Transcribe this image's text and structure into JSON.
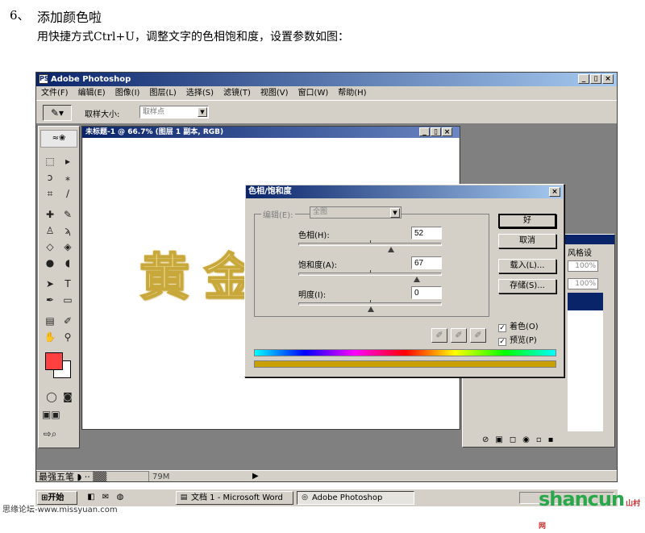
{
  "article": {
    "step_number": "6、",
    "step_title": "添加颜色啦",
    "step_desc": "用快捷方式Ctrl+U，调整文字的色相饱和度，设置参数如图："
  },
  "app": {
    "title": "Adobe Photoshop",
    "logo": "PS",
    "win_buttons": [
      "_",
      "▯",
      "×"
    ],
    "menus": [
      "文件(F)",
      "编辑(E)",
      "图像(I)",
      "图层(L)",
      "选择(S)",
      "滤镜(T)",
      "视图(V)",
      "窗口(W)",
      "帮助(H)"
    ],
    "options": {
      "tool_icon": "eyedropper-icon",
      "sample_label": "取样大小:",
      "sample_value": "取样点",
      "select_arrow": "▼"
    },
    "toolbox_logo": "≈❀"
  },
  "document": {
    "title": "未标题-1 @ 66.7% (图层 1 副本, RGB)",
    "canvas_text": "黄金"
  },
  "layers_panel": {
    "tab": "风格设",
    "opacity": "100%",
    "fill": "100%",
    "bottom_icons": "⊘▣◻◉▫▪"
  },
  "status_bar": {
    "ime": "最强五笔",
    "ime_icons": "◗ ·· ▒▒",
    "zoom_fragment": "79M",
    "play_arrow": "▶"
  },
  "dialog": {
    "title": "色相/饱和度",
    "close": "×",
    "edit_label": "编辑(E):",
    "edit_value": "全图",
    "hue_label": "色相(H):",
    "hue_value": "52",
    "hue_level": 52,
    "saturation_label": "饱和度(A):",
    "saturation_value": "67",
    "saturation_level": 67,
    "lightness_label": "明度(I):",
    "lightness_value": "0",
    "lightness_level": 0,
    "btn_ok": "好",
    "btn_cancel": "取消",
    "btn_load": "载入(L)...",
    "btn_save": "存储(S)...",
    "colorize_label": "着色(O)",
    "colorize_checked": true,
    "preview_label": "预览(P)",
    "preview_checked": true,
    "check_mark": "✓"
  },
  "taskbar": {
    "start": "开始",
    "word_task": "文档 1 - Microsoft Word",
    "ps_task": "Adobe Photoshop"
  },
  "footer": {
    "credit": "思缘论坛-www.missyuan.com"
  },
  "watermark": {
    "text": "shancun",
    "sub": "山村网"
  }
}
